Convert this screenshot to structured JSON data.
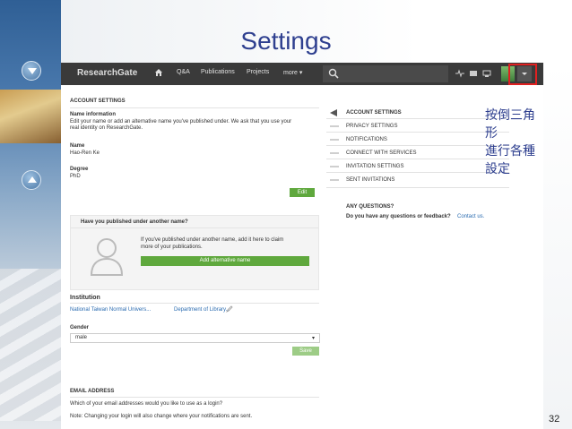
{
  "slide": {
    "title": "Settings",
    "annotation_lines": [
      "按倒三角形",
      "進行各種",
      "設定"
    ],
    "page_number": "32"
  },
  "topbar": {
    "logo": "ResearchGate",
    "nav": [
      "Q&A",
      "Publications",
      "Projects",
      "more ▾"
    ]
  },
  "account": {
    "heading": "ACCOUNT SETTINGS",
    "name_info_heading": "Name information",
    "name_info_text_1": "Edit your name or add an alternative name you've published under. We ask that you use your",
    "name_info_text_2": "real identity on ResearchGate.",
    "name_label": "Name",
    "name_value": "Hao-Ren Ke",
    "degree_label": "Degree",
    "degree_value": "PhD",
    "edit_label": "Edit"
  },
  "alternative": {
    "heading": "Have you published under another name?",
    "text_1": "If you've published under another name, add it here to claim",
    "text_2": "more of your publications.",
    "button": "Add alternative name"
  },
  "institution": {
    "heading": "Institution",
    "university": "National Taiwan Normal Univers...",
    "department": "Department of Library..."
  },
  "gender": {
    "label": "Gender",
    "value": "male",
    "save_label": "Save"
  },
  "email": {
    "heading": "EMAIL ADDRESS",
    "text_1": "Which of your email addresses would you like to use as a login?",
    "text_2": "Note: Changing your login will also change where your notifications are sent."
  },
  "sidebar": {
    "items": [
      "ACCOUNT SETTINGS",
      "PRIVACY SETTINGS",
      "NOTIFICATIONS",
      "CONNECT WITH SERVICES",
      "INVITATION SETTINGS",
      "SENT INVITATIONS"
    ],
    "questions_heading": "ANY QUESTIONS?",
    "questions_text": "Do you have any questions or feedback?",
    "contact_link": "Contact us."
  },
  "colors": {
    "title": "#2e3f8f",
    "topbar": "#3a3a3a",
    "button_green": "#5fa83d",
    "highlight": "#e02020",
    "link": "#2a6bb0"
  }
}
